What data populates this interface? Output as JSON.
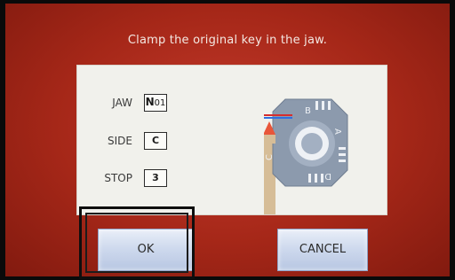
{
  "instruction": "Clamp the original key in the jaw.",
  "params": [
    {
      "label": "JAW",
      "value_prefix": "N",
      "value_suffix": "01"
    },
    {
      "label": "SIDE",
      "value": "C"
    },
    {
      "label": "STOP",
      "value": "3"
    }
  ],
  "diagram": {
    "side_letters": [
      "B",
      "A",
      "D",
      "C"
    ],
    "colors": {
      "jaw_body": "#8c9aad",
      "jaw_face": "#a3b0c2",
      "key_shaft": "#d6bd97",
      "pointer": "#e8563a",
      "line_red": "#d62d2d",
      "line_blue": "#2f6fe0"
    }
  },
  "buttons": {
    "ok_label": "OK",
    "cancel_label": "CANCEL"
  },
  "colors": {
    "screen_bg": "#a52718",
    "button_face": "#cfdaee"
  }
}
